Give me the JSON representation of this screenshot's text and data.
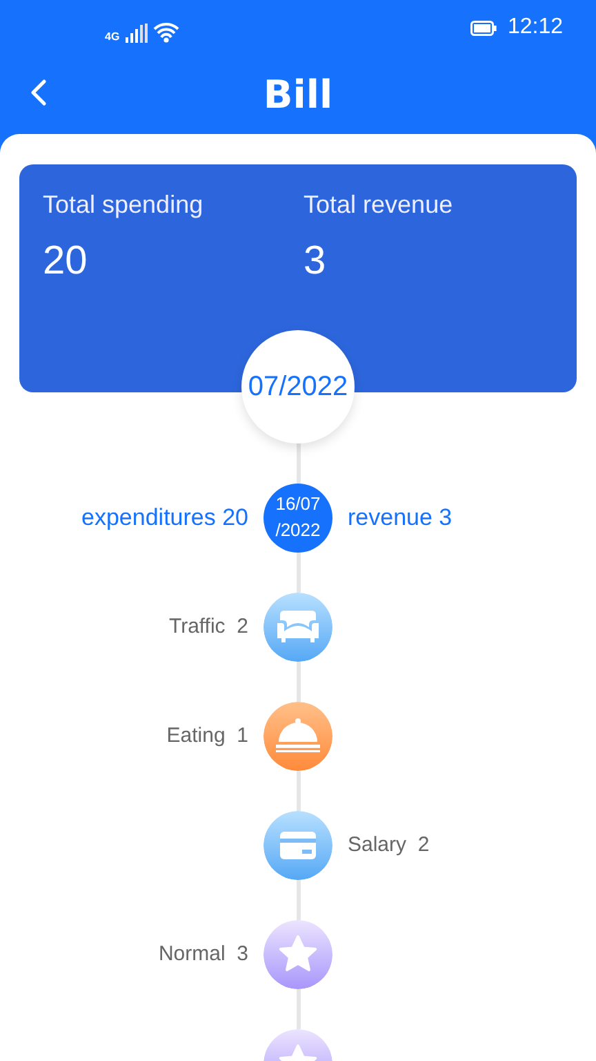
{
  "status_bar": {
    "network": "4G",
    "time": "12:12"
  },
  "header": {
    "title": "Bill"
  },
  "summary": {
    "items": [
      {
        "label": "Total spending",
        "value": "20"
      },
      {
        "label": "Total revenue",
        "value": "3"
      }
    ],
    "month": "07/2022"
  },
  "timeline": [
    {
      "kind": "day",
      "date": "16/07\n/2022",
      "left": "expenditures 20",
      "right": "revenue 3"
    },
    {
      "kind": "traffic",
      "label": "Traffic  2"
    },
    {
      "kind": "eating",
      "label": "Eating  1"
    },
    {
      "kind": "salary",
      "label": "Salary  2"
    },
    {
      "kind": "normal",
      "label": "Normal  3"
    },
    {
      "kind": "normal"
    }
  ]
}
